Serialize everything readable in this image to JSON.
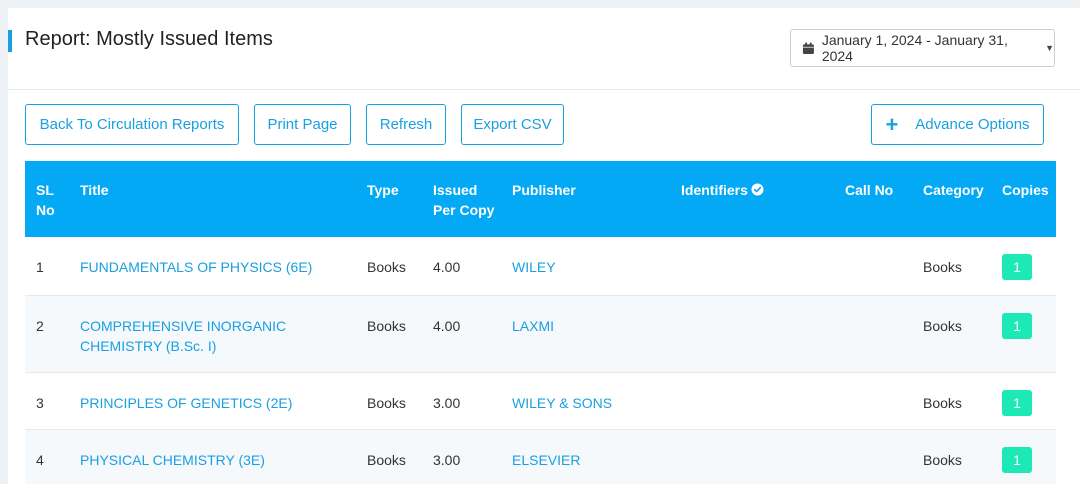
{
  "header": {
    "title": "Report: Mostly Issued Items",
    "date_range": "January 1, 2024 - January 31, 2024"
  },
  "toolbar": {
    "back_label": "Back To Circulation Reports",
    "print_label": "Print Page",
    "refresh_label": "Refresh",
    "export_label": "Export CSV",
    "advance_label": "Advance Options",
    "advance_icon": "+"
  },
  "table": {
    "columns": {
      "sl": "SL No",
      "title": "Title",
      "type": "Type",
      "issued": "Issued Per Copy",
      "publisher": "Publisher",
      "identifiers": "Identifiers",
      "callno": "Call No",
      "category": "Category",
      "copies": "Copies"
    },
    "rows": [
      {
        "sl": "1",
        "title": "FUNDAMENTALS OF PHYSICS (6E)",
        "type": "Books",
        "issued": "4.00",
        "publisher": "WILEY",
        "identifiers": "",
        "callno": "",
        "category": "Books",
        "copies": "1"
      },
      {
        "sl": "2",
        "title": "COMPREHENSIVE INORGANIC CHEMISTRY (B.Sc. I)",
        "type": "Books",
        "issued": "4.00",
        "publisher": "LAXMI",
        "identifiers": "",
        "callno": "",
        "category": "Books",
        "copies": "1"
      },
      {
        "sl": "3",
        "title": "PRINCIPLES OF GENETICS (2E)",
        "type": "Books",
        "issued": "3.00",
        "publisher": "WILEY & SONS",
        "identifiers": "",
        "callno": "",
        "category": "Books",
        "copies": "1"
      },
      {
        "sl": "4",
        "title": "PHYSICAL CHEMISTRY (3E)",
        "type": "Books",
        "issued": "3.00",
        "publisher": "ELSEVIER",
        "identifiers": "",
        "callno": "",
        "category": "Books",
        "copies": "1"
      }
    ]
  },
  "colors": {
    "accent": "#1a9fe0",
    "table_header": "#03a9f4",
    "copies_badge": "#1de9b6"
  },
  "icons": {
    "date": "calendar-icon",
    "date_caret": "caret-down-icon",
    "identifiers": "check-circle-icon",
    "advance": "plus-icon"
  }
}
